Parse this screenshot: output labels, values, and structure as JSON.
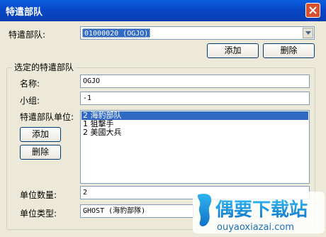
{
  "window": {
    "title": "特遣部队"
  },
  "task_force": {
    "label": "特遣部队:",
    "selected": "01000020  (OGJO)",
    "add_label": "添加",
    "delete_label": "删除"
  },
  "selected_group": {
    "title": "选定的特遣部队",
    "name_label": "名称:",
    "name_value": "OGJO",
    "group_label": "小组:",
    "group_value": "-1",
    "units_label": "特遣部队单位:",
    "add_label": "添加",
    "delete_label": "删除",
    "units": [
      "2 海豹部队",
      "1 狙擊手",
      "2 美國大兵"
    ],
    "selected_unit_index": 0,
    "count_label": "单位数量:",
    "count_value": "2",
    "type_label": "单位类型:",
    "type_value": "GHOST (海豹部隊)"
  },
  "watermark": {
    "brand": "偶要下载站",
    "url": "ouyaoxiazai.com"
  },
  "colors": {
    "titlebar": "#0747c6",
    "selection": "#316ac5",
    "close": "#d8502e",
    "watermark": "#1a8fd8"
  }
}
